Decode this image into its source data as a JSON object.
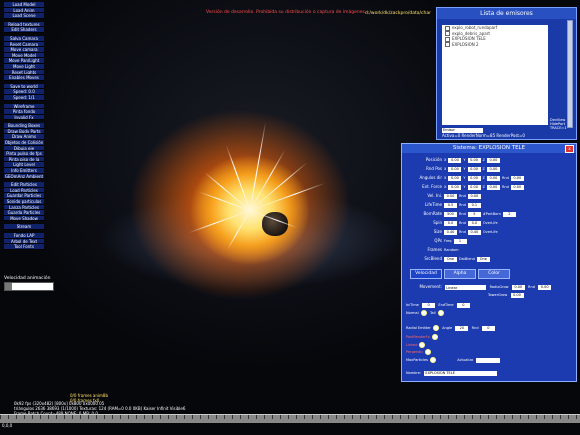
{
  "viewport": {
    "warning": "Versión de desarrollo. Prohibida su distribución o captura de imágenes",
    "path": "d:/work/dk/zackpro/data/char"
  },
  "left_menu": {
    "groups": [
      [
        "Load Model",
        "Load Anim",
        "Load Scene"
      ],
      [
        "Reload textures",
        "Edit Shaders"
      ],
      [
        "Salva Camara",
        "Reset Camara",
        "Move camara",
        "Move Model",
        "Move Pan/Light",
        "Move Light",
        "Reset Lights",
        "Enables Moves"
      ],
      [
        "Save to world",
        "Speed: 0.0",
        "Speed: 1/1"
      ],
      [
        "Wireframe",
        "Pinta fondo",
        "Invalid Fx"
      ],
      [
        "Bounding Boxes",
        "Draw Body Parts",
        "Draw Anims",
        "Objetos de Colisión",
        "Dibuja eje",
        "Pinta pulso de fps",
        "Pinta piso de la",
        "Light Level",
        "Info Emitters",
        "GEOmAnz Ambient"
      ],
      [
        "Edit Particles",
        "Load Particles",
        "Guardar Particles",
        "Sonido particulas",
        "Lanza Particles",
        "Guarda Particles",
        "Move Shadow"
      ],
      [
        "Stream"
      ],
      [
        "Fondo LAP",
        "Arbol de Text",
        "Tool Fonts"
      ]
    ],
    "velocity_label": "Velocidad animación",
    "velocity_value": "0"
  },
  "emitter_list": {
    "title": "Lista de emisores",
    "items": [
      "explo_robot_rundaparf",
      "explo_debris_apart",
      "EXPLOSION TELE",
      "EXPLOSION 2"
    ],
    "dev_buttons": "DevView HIdePart TRACE=1",
    "mode_label": "Emisor",
    "status": "Activa=0 RenderNorm=85 RenderPost=0"
  },
  "system": {
    "title": "Sistema: EXPLOSION TELE",
    "close": "x",
    "rows": [
      {
        "label": "Posición",
        "fields": [
          "X",
          "0.00",
          "Y",
          "0.00",
          "Z",
          "0.00"
        ]
      },
      {
        "label": "Rnd Pos",
        "fields": [
          "X",
          "0.00",
          "Y",
          "0.00",
          "Z",
          "0.00"
        ]
      },
      {
        "label": "Angulos dir",
        "fields": [
          "X",
          "0.00",
          "Y",
          "0.00",
          "Z",
          "0.00",
          "Rnd",
          "0.00"
        ]
      },
      {
        "label": "Ext. Force",
        "fields": [
          "X",
          "0.00",
          "Y",
          "0.00",
          "Z",
          "0.00",
          "Rnd",
          "0.00"
        ]
      },
      {
        "label": "Vel. Ini.",
        "fields": [
          "0.00",
          "Rnd",
          "0.00"
        ]
      },
      {
        "label": "LifeTime",
        "fields": [
          "0.5",
          "Rnd",
          "0.1"
        ]
      },
      {
        "label": "BornRate",
        "fields": [
          "500",
          "Rnd",
          "5",
          "#PartBorn",
          "2"
        ]
      },
      {
        "label": "Spin",
        "fields": [
          "0.0",
          "Rnd",
          "0.0",
          "OverLife"
        ]
      },
      {
        "label": "Size",
        "fields": [
          "0.40",
          "Rnd",
          "0.40",
          "OverLife"
        ]
      },
      {
        "label": "QPs",
        "fields": [
          "Freq",
          "1"
        ]
      },
      {
        "label": "Frames",
        "fields": [
          "Random"
        ]
      },
      {
        "label": "SrcBlend",
        "fields": [
          "One",
          "DstBlend",
          "One"
        ]
      }
    ],
    "tabs": [
      "Velocidad",
      "Alpha",
      "Color"
    ],
    "movement_label": "Movement:",
    "movement_value": "Linear",
    "radio_grow": "RadioGrow",
    "radio_grow_value": "0.00",
    "tower_grow": "TowerGrow",
    "tower_grow_value": "0.00",
    "rnd_label": "Rnd",
    "rnd_value": "0.00",
    "init_time": "IniTime",
    "init_time_value": "0",
    "end_time": "EndTime",
    "end_time_value": "0",
    "normal": "Normal",
    "tail": "Tail",
    "radial_emitter": "Radial Emitter",
    "angle_label": "Angle",
    "angle_value": "20",
    "rnd2_value": "0",
    "post_render": "PostRenderFx",
    "linked": "Linked",
    "perpendic": "Perpendic",
    "max_particles": "MaxParticles",
    "actualiza": "Actualiza",
    "name_label": "Nombre:",
    "name_value": "EXPLOSION TELE"
  },
  "bottom": {
    "frames_anim": "0/0 frames anim8b",
    "frames_fx": "0/0 frames fx0",
    "stats": [
      "0k92 fps (320x482) [800x] 0x800 0x0000 05",
      "triángulos 2636 38693 (1/1000) Texturas: 124 (RAM=0 0.0 0KB) Kaiser Infinit Visible6",
      "Frame Batch Count=489 NONE: 0 MB: 0 0",
      "x: 0/0 [00 0.0] 0.0"
    ],
    "coord": "0,0,0"
  },
  "colors": {
    "panel": "#1c3bb0",
    "menu": "#10236a",
    "warning": "#ff4d4d",
    "path": "#ffe36b"
  }
}
